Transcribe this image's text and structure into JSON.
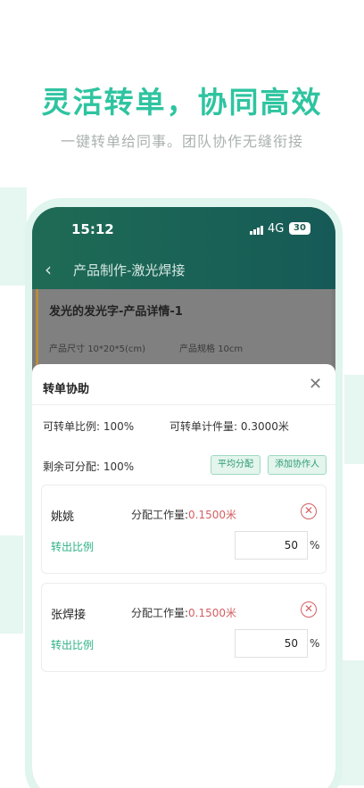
{
  "promo": {
    "headline": "灵活转单，协同高效",
    "subline": "一键转单给同事。团队协作无缝衔接"
  },
  "status_bar": {
    "time": "15:12",
    "network": "4G",
    "battery": "30"
  },
  "nav": {
    "back_icon": "chevron-left-icon",
    "title": "产品制作-激光焊接"
  },
  "detail": {
    "title": "发光的发光字-产品详情-1",
    "size_label": "产品尺寸",
    "size_value": "10*20*5(cm)",
    "spec_label": "产品规格",
    "spec_value": "10cm"
  },
  "sheet": {
    "title": "转单协助",
    "close_icon": "close-icon",
    "transferable_ratio_label": "可转单比例:",
    "transferable_ratio_value": "100%",
    "transferable_qty_label": "可转单计件量:",
    "transferable_qty_value": "0.3000米",
    "remaining_label": "剩余可分配:",
    "remaining_value": "100%",
    "even_split_button": "平均分配",
    "add_collaborator_button": "添加协作人",
    "assignees": [
      {
        "name": "姚姚",
        "work_label": "分配工作量:",
        "work_value": "0.1500米",
        "ratio_label": "转出比例",
        "ratio_value": "50",
        "unit": "%"
      },
      {
        "name": "张焊接",
        "work_label": "分配工作量:",
        "work_value": "0.1500米",
        "ratio_label": "转出比例",
        "ratio_value": "50",
        "unit": "%"
      }
    ]
  },
  "colors": {
    "accent": "#2ec4a0",
    "header": "#1e6b55",
    "danger": "#d35f62"
  }
}
